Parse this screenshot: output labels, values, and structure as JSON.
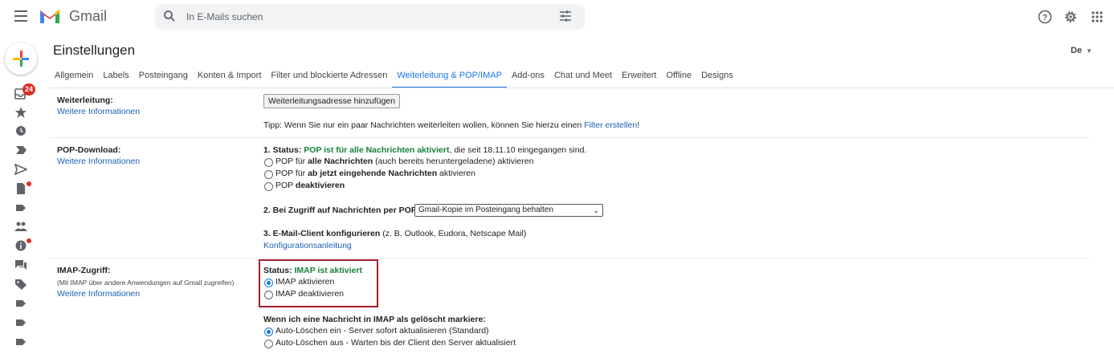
{
  "header": {
    "brand": "Gmail",
    "search_placeholder": "In E-Mails suchen",
    "inbox_badge": "24"
  },
  "page": {
    "title": "Einstellungen",
    "lang": "De"
  },
  "tabs": [
    {
      "label": "Allgemein"
    },
    {
      "label": "Labels"
    },
    {
      "label": "Posteingang"
    },
    {
      "label": "Konten & Import"
    },
    {
      "label": "Filter und blockierte Adressen"
    },
    {
      "label": "Weiterleitung & POP/IMAP"
    },
    {
      "label": "Add-ons"
    },
    {
      "label": "Chat und Meet"
    },
    {
      "label": "Erweitert"
    },
    {
      "label": "Offline"
    },
    {
      "label": "Designs"
    }
  ],
  "forwarding": {
    "label": "Weiterleitung:",
    "more": "Weitere Informationen",
    "add_button": "Weiterleitungsadresse hinzufügen",
    "tip_prefix": "Tipp: Wenn Sie nur ein paar Nachrichten weiterleiten wollen, können Sie hierzu einen ",
    "tip_link": "Filter erstellen",
    "tip_suffix": "!"
  },
  "pop": {
    "label": "POP-Download:",
    "more": "Weitere Informationen",
    "status_prefix": "1. Status: ",
    "status_green": "POP ist für alle Nachrichten aktiviert",
    "status_suffix": ", die seit 18.11.10 eingegangen sind.",
    "opt1_a": "POP für ",
    "opt1_b": "alle Nachrichten",
    "opt1_c": " (auch bereits heruntergeladene) aktivieren",
    "opt2_a": "POP für ",
    "opt2_b": "ab jetzt eingehende Nachrichten",
    "opt2_c": " aktivieren",
    "opt3_a": "POP ",
    "opt3_b": "deaktivieren",
    "access_label": "2. Bei Zugriff auf Nachrichten per POP",
    "access_select": "Gmail-Kopie im Posteingang behalten",
    "client_bold": "3. E-Mail-Client konfigurieren",
    "client_rest": " (z. B. Outlook, Eudora, Netscape Mail)",
    "client_link": "Konfigurationsanleitung"
  },
  "imap": {
    "label": "IMAP-Zugriff:",
    "sub": "(Mit IMAP über andere Anwendungen auf Gmail zugreifen)",
    "more": "Weitere Informationen",
    "status_prefix": "Status: ",
    "status_green": "IMAP ist aktiviert",
    "enable": "IMAP aktivieren",
    "disable": "IMAP deaktivieren",
    "delete_heading": "Wenn ich eine Nachricht in IMAP als gelöscht markiere:",
    "del_opt1": "Auto-Löschen ein - Server sofort aktualisieren (Standard)",
    "del_opt2": "Auto-Löschen aus - Warten bis der Client den Server aktualisiert"
  },
  "colors": {
    "accent": "#1a73e8",
    "green": "#188038",
    "highlight_box": "#a31d2a",
    "badge": "#d93025"
  }
}
